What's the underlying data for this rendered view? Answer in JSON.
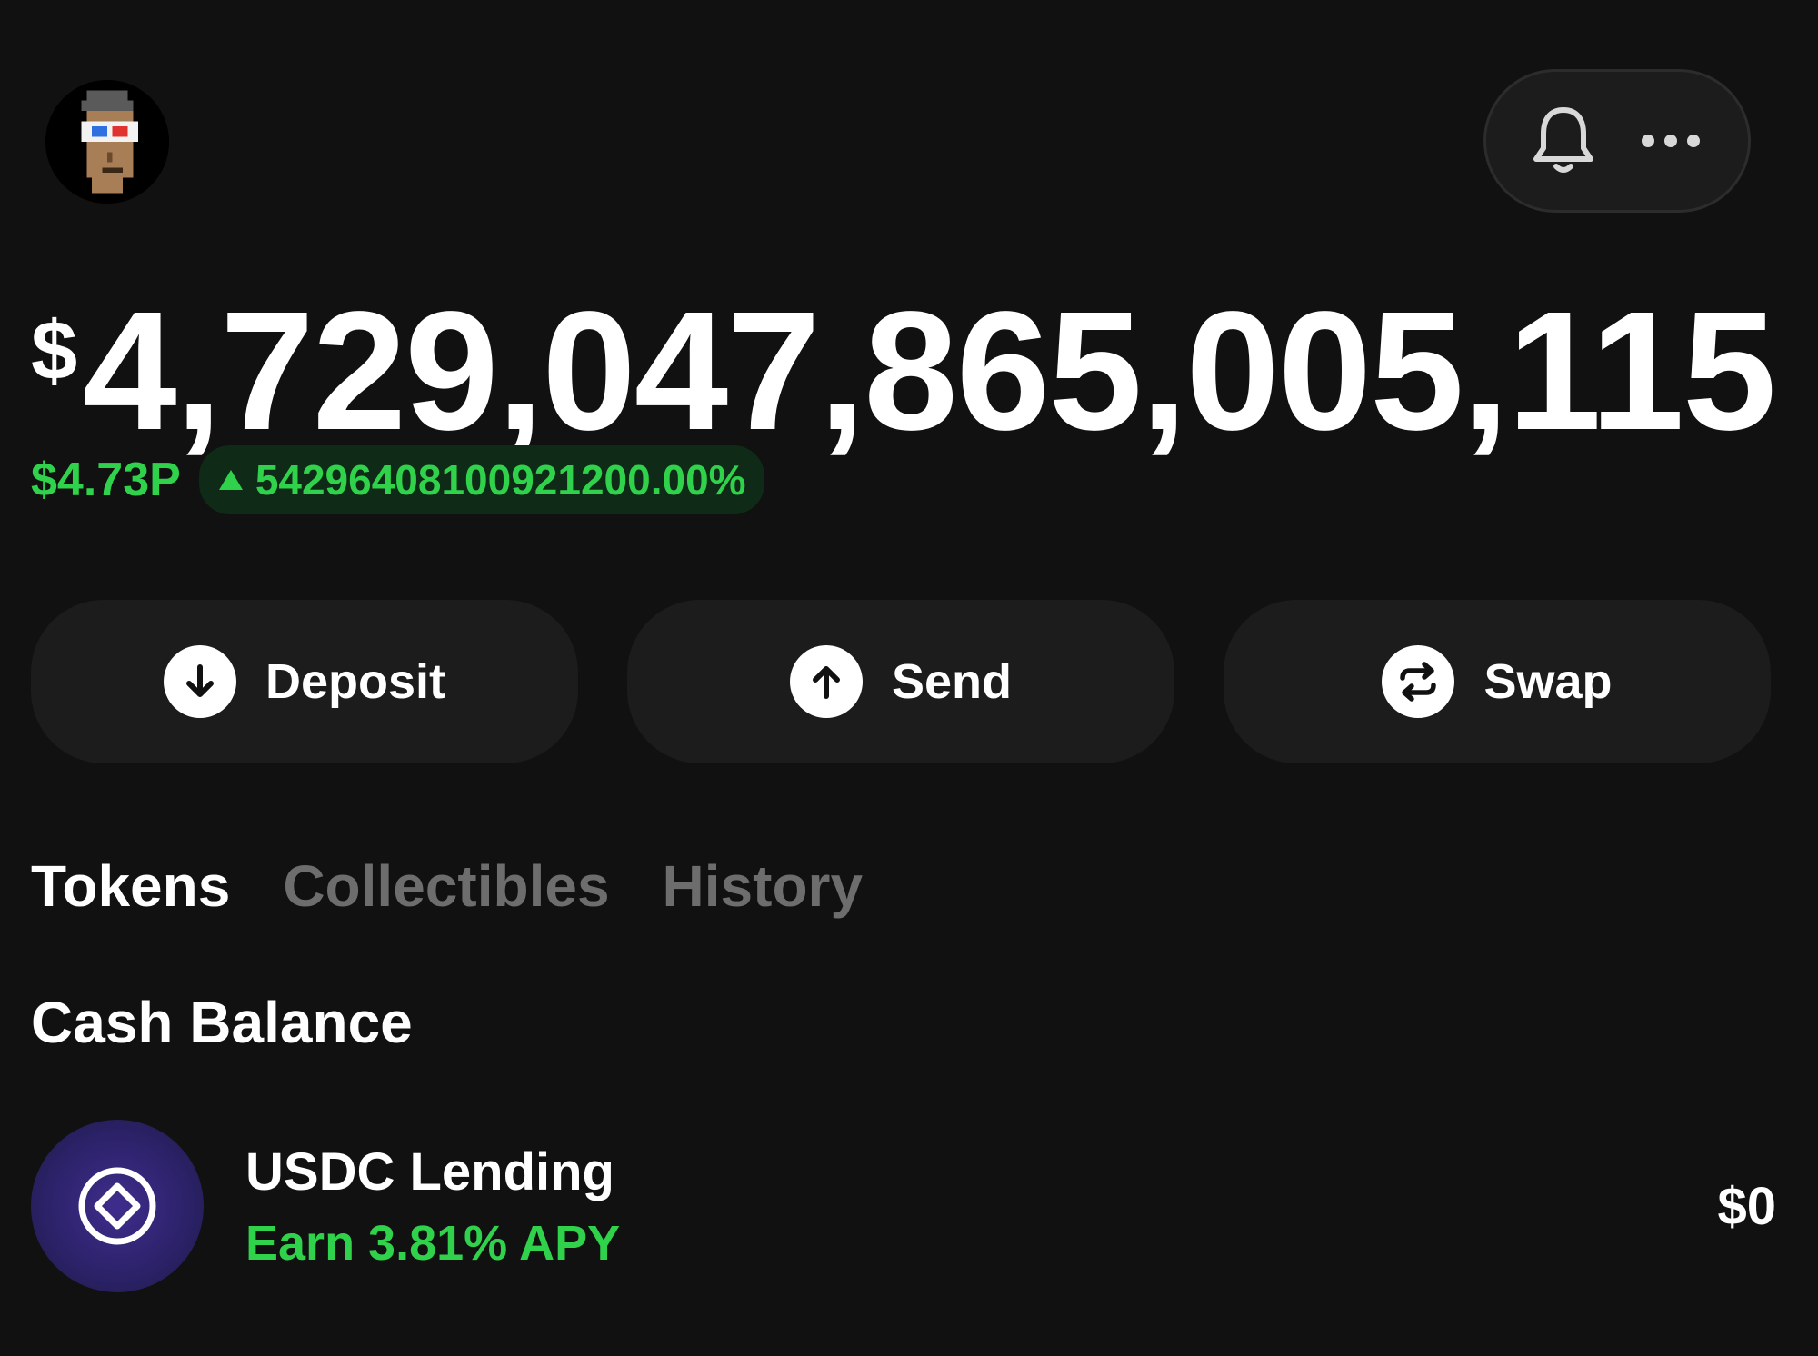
{
  "header": {
    "avatar_icon": "pixel-punk-avatar-3d-glasses",
    "notification_icon": "bell-icon",
    "more_icon": "more-horizontal-icon"
  },
  "balance": {
    "currency_symbol": "$",
    "amount": "4,729,047,865,005,115",
    "change_amount": "$4.73P",
    "change_percent": "54296408100921200.00%",
    "change_direction": "up"
  },
  "actions": [
    {
      "label": "Deposit",
      "icon": "arrow-down-icon"
    },
    {
      "label": "Send",
      "icon": "arrow-up-icon"
    },
    {
      "label": "Swap",
      "icon": "swap-icon"
    }
  ],
  "tabs": [
    {
      "label": "Tokens",
      "active": true
    },
    {
      "label": "Collectibles",
      "active": false
    },
    {
      "label": "History",
      "active": false
    }
  ],
  "cash_balance": {
    "title": "Cash Balance",
    "items": [
      {
        "name": "USDC Lending",
        "subtitle": "Earn 3.81% APY",
        "value": "$0",
        "icon": "usdc-lending-icon"
      }
    ]
  },
  "colors": {
    "background": "#111111",
    "surface": "#1c1c1c",
    "positive": "#2fd24a",
    "inactive_tab": "#6d6d6d",
    "token_icon": "#2a2166"
  }
}
